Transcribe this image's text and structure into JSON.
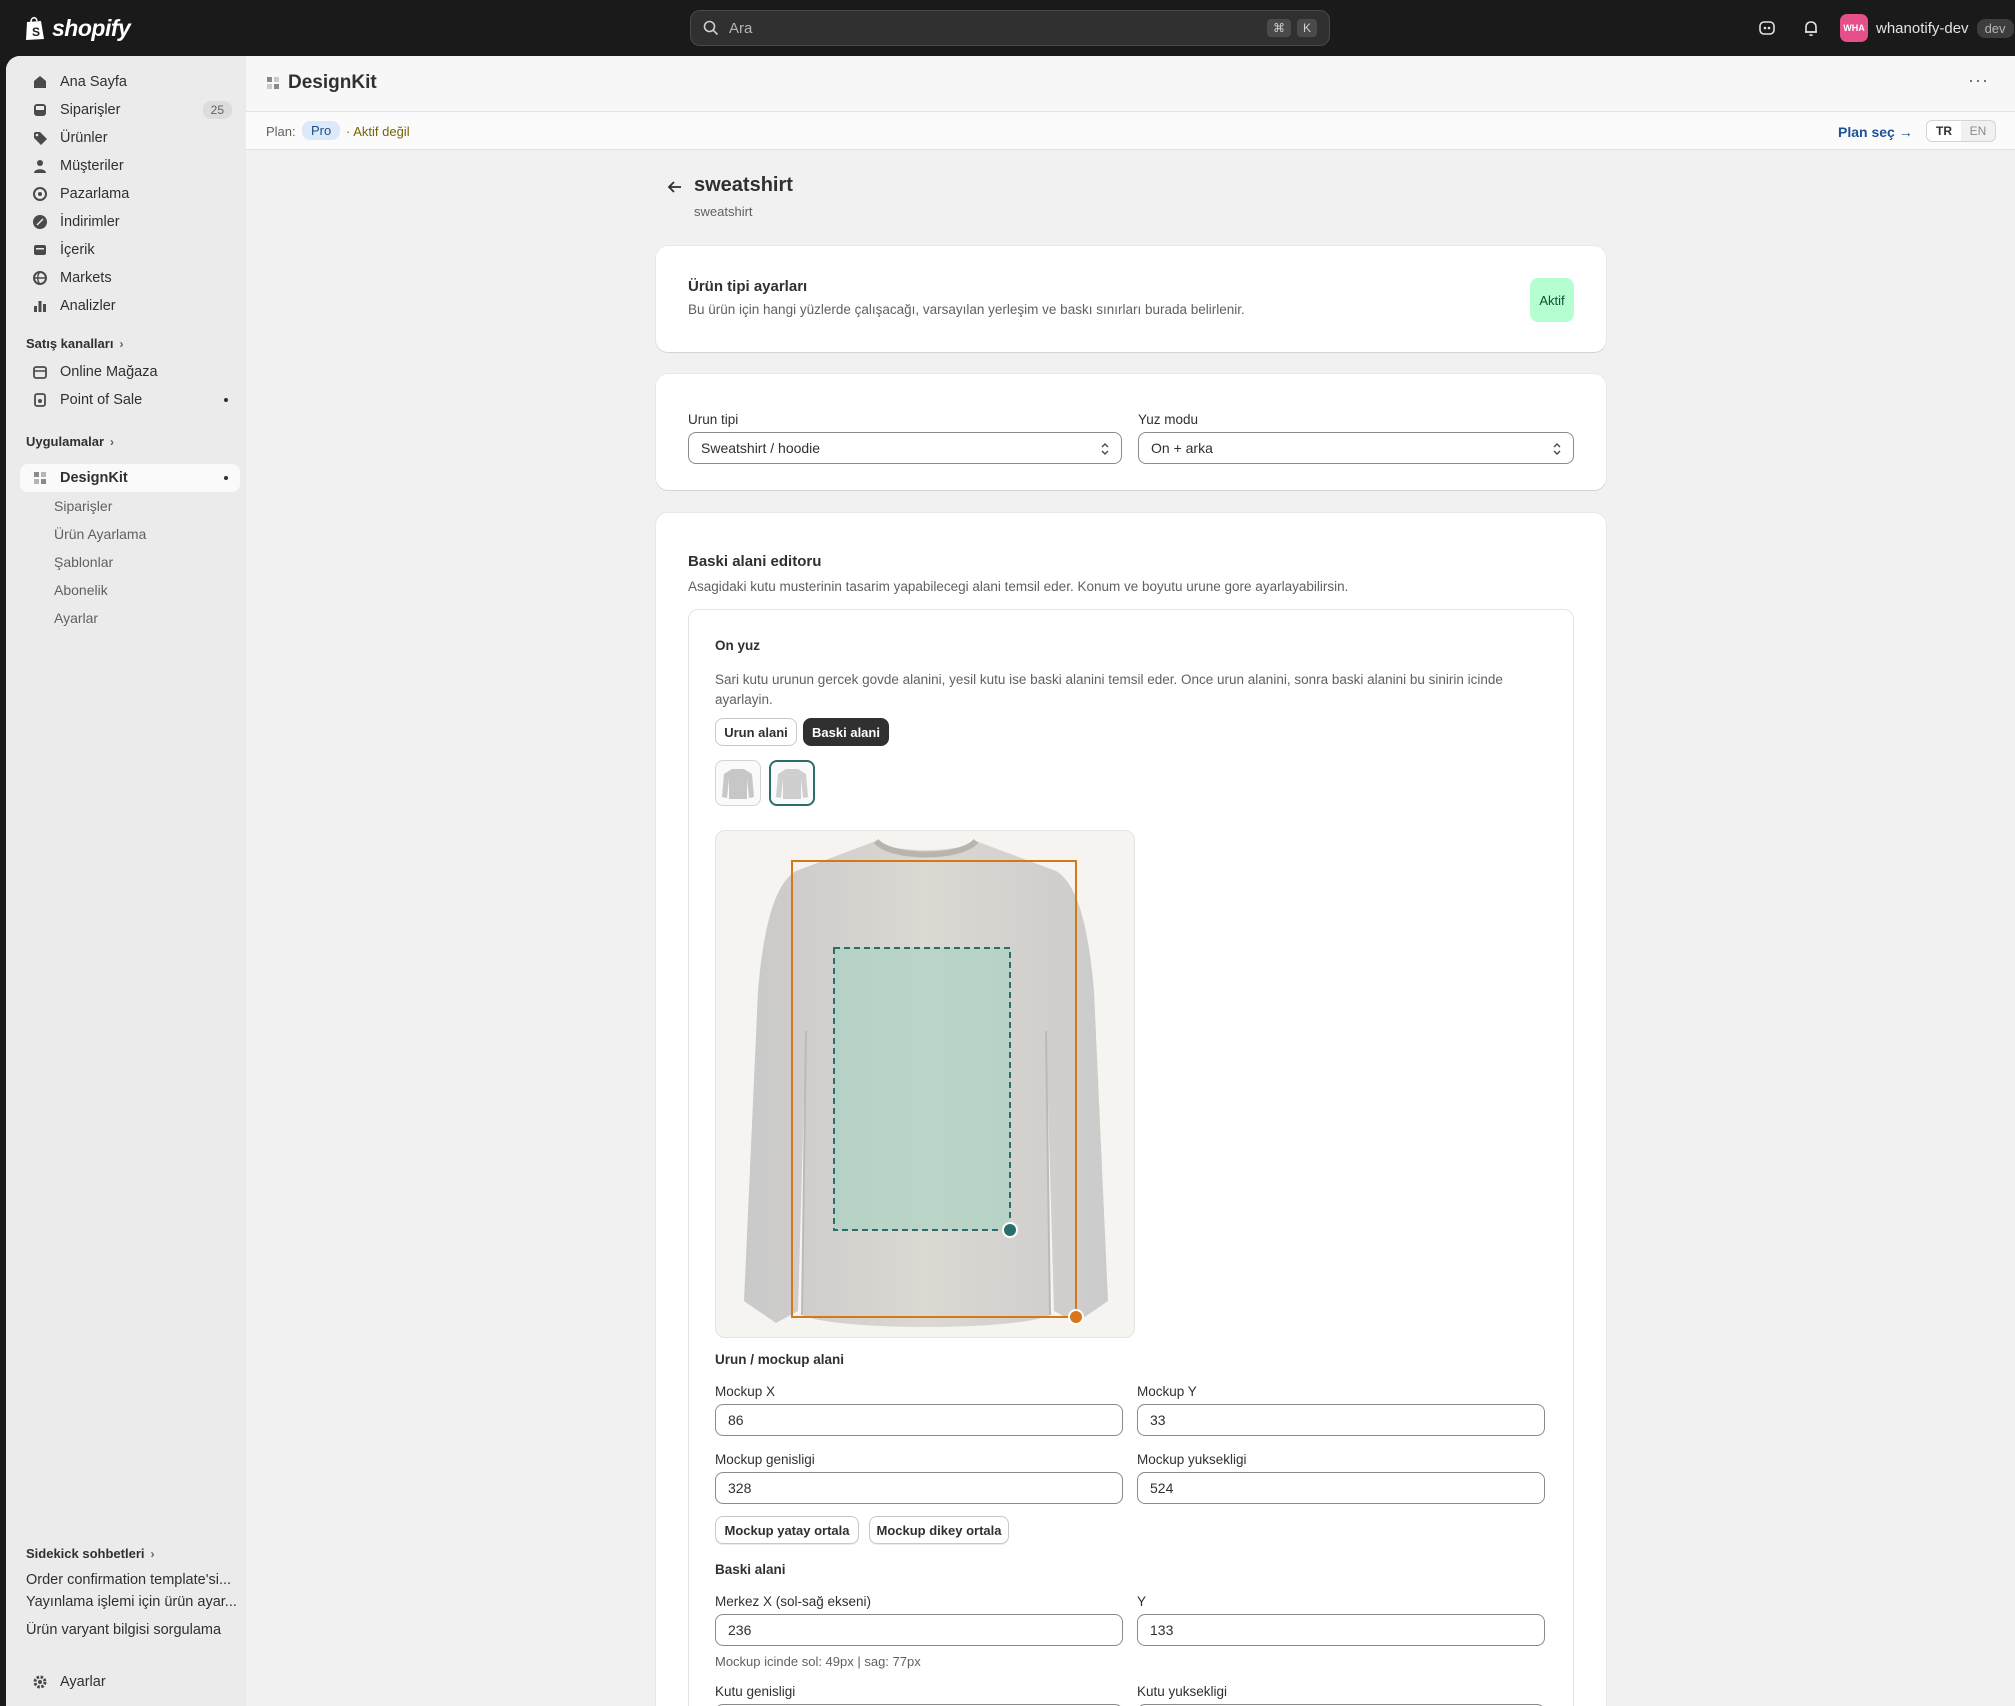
{
  "topbar": {
    "logo_text": "shopify",
    "search_placeholder": "Ara",
    "shortcut_keys": [
      "⌘",
      "K"
    ],
    "store_avatar": "WHA",
    "store_name": "whanotify-dev",
    "store_badge": "dev"
  },
  "sidebar": {
    "items": [
      {
        "label": "Ana Sayfa",
        "icon": "home-icon"
      },
      {
        "label": "Siparişler",
        "icon": "inbox-icon",
        "count": "25"
      },
      {
        "label": "Ürünler",
        "icon": "tag-icon"
      },
      {
        "label": "Müşteriler",
        "icon": "person-icon"
      },
      {
        "label": "Pazarlama",
        "icon": "target-icon"
      },
      {
        "label": "İndirimler",
        "icon": "discount-icon"
      },
      {
        "label": "İçerik",
        "icon": "content-icon"
      },
      {
        "label": "Markets",
        "icon": "globe-icon"
      },
      {
        "label": "Analizler",
        "icon": "chart-icon"
      }
    ],
    "sales_channels_label": "Satış kanalları",
    "channels": [
      {
        "label": "Online Mağaza",
        "icon": "store-icon"
      },
      {
        "label": "Point of Sale",
        "icon": "pos-icon"
      }
    ],
    "apps_label": "Uygulamalar",
    "app": {
      "label": "DesignKit",
      "icon": "app-grid-icon"
    },
    "app_subitems": [
      "Siparişler",
      "Ürün Ayarlama",
      "Şablonlar",
      "Abonelik",
      "Ayarlar"
    ],
    "sidekick_label": "Sidekick sohbetleri",
    "sidekick_items": [
      "Order confirmation template'si...",
      "Yayınlama işlemi için ürün ayar...",
      "Ürün varyant bilgisi sorgulama"
    ],
    "settings_label": "Ayarlar"
  },
  "app_header": {
    "title": "DesignKit",
    "more": "···"
  },
  "plan_bar": {
    "label": "Plan:",
    "plan": "Pro",
    "status": "· Aktif değil",
    "select_link": "Plan seç →",
    "lang_options": [
      "TR",
      "EN"
    ],
    "lang_selected": "TR"
  },
  "page": {
    "title": "sweatshirt",
    "subtitle": "sweatshirt"
  },
  "settings_card": {
    "heading": "Ürün tipi ayarları",
    "description": "Bu ürün için hangi yüzlerde çalışacağı, varsayılan yerleşim ve baskı sınırları burada belirlenir.",
    "badge": "Aktif"
  },
  "type_card": {
    "product_type_label": "Urun tipi",
    "product_type_value": "Sweatshirt / hoodie",
    "face_mode_label": "Yuz modu",
    "face_mode_value": "On + arka"
  },
  "editor_card": {
    "heading": "Baski alani editoru",
    "description": "Asagidaki kutu musterinin tasarim yapabilecegi alani temsil eder. Konum ve boyutu urune gore ayarlayabilirsin.",
    "face": {
      "title": "On yuz",
      "description": "Sari kutu urunun gercek govde alanini, yesil kutu ise baski alanini temsil eder. Once urun alanini, sonra baski alanini bu sinirin icinde ayarlayin.",
      "mode_buttons": [
        "Urun alani",
        "Baski alani"
      ],
      "mode_selected": "Baski alani",
      "selected_thumbnail": 2
    },
    "mockup_section": {
      "heading": "Urun / mockup alani",
      "x_label": "Mockup X",
      "x_value": "86",
      "y_label": "Mockup Y",
      "y_value": "33",
      "w_label": "Mockup genisligi",
      "w_value": "328",
      "h_label": "Mockup yuksekligi",
      "h_value": "524",
      "center_h_button": "Mockup yatay ortala",
      "center_v_button": "Mockup dikey ortala"
    },
    "print_section": {
      "heading": "Baski alani",
      "cx_label": "Merkez X (sol-sağ ekseni)",
      "cx_value": "236",
      "y_label": "Y",
      "y_value": "133",
      "helper": "Mockup icinde sol: 49px | sag: 77px",
      "w_label": "Kutu genisligi",
      "h_label": "Kutu yuksekligi"
    }
  },
  "colors": {
    "mockup_box": "#d6781a",
    "print_box": "#2b6d6a",
    "print_fill": "#9fd3c0",
    "accent_link": "#1f5199",
    "active_badge": "#b4fed2"
  }
}
